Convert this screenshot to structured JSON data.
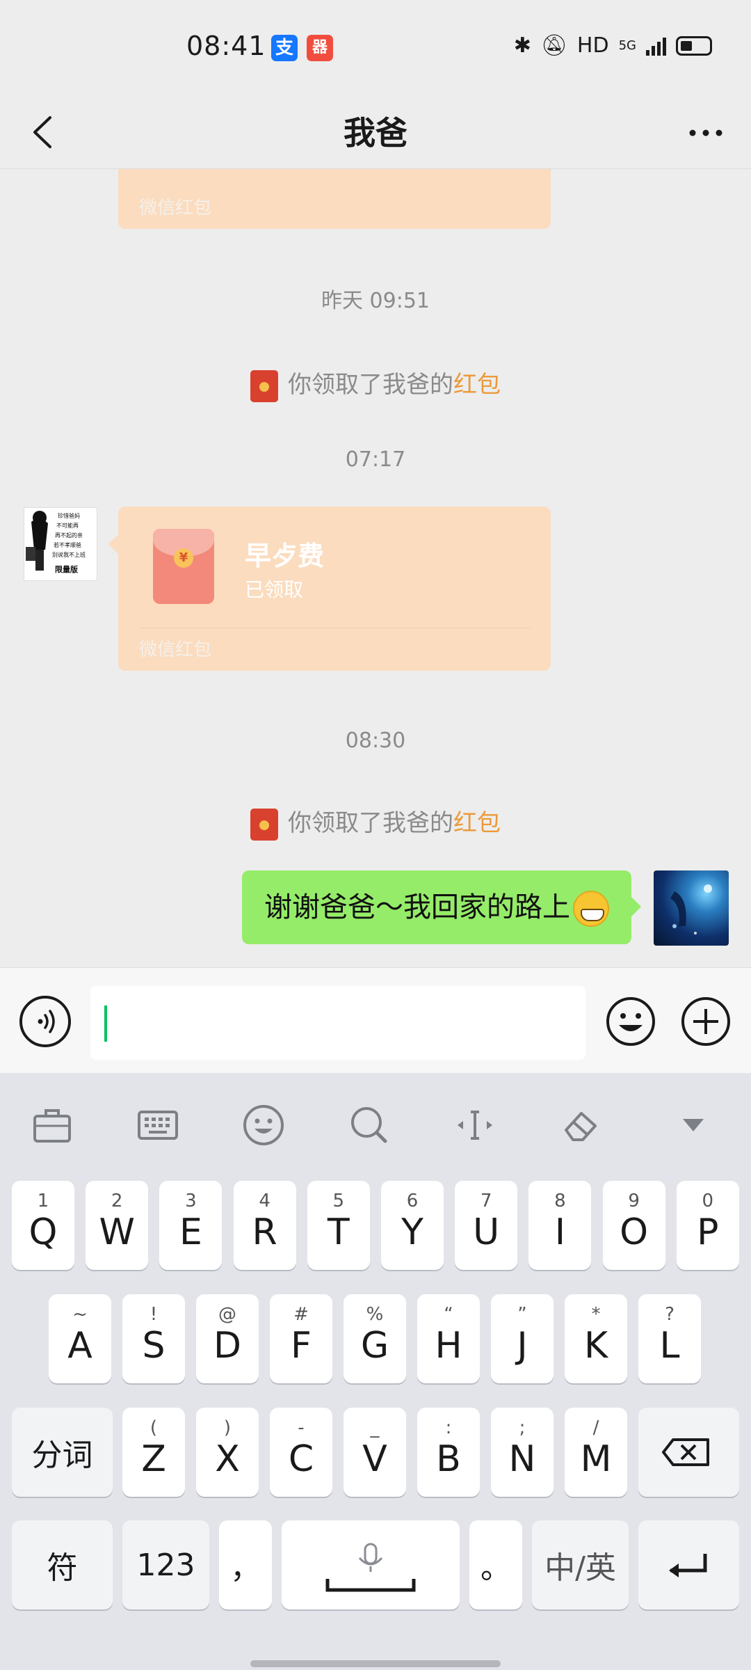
{
  "status_bar": {
    "time": "08:41",
    "app_icons": [
      {
        "name": "alipay-icon",
        "glyph": "支",
        "color": "#1677ff"
      },
      {
        "name": "app-icon",
        "glyph": "器",
        "color": "#f04d3f"
      }
    ],
    "network": "HD",
    "network_type": "5G"
  },
  "header": {
    "title": "我爸"
  },
  "chat": {
    "top_red_packet_footer": "微信红包",
    "messages": [
      {
        "type": "timestamp",
        "text": "昨天 09:51"
      },
      {
        "type": "system",
        "prefix": "你领取了我爸的",
        "highlight": "红包"
      },
      {
        "type": "timestamp",
        "text": "07:17"
      },
      {
        "type": "system",
        "prefix": "你领取了我爸的",
        "highlight": "红包"
      },
      {
        "type": "timestamp",
        "text": "08:30"
      }
    ],
    "red_packet": {
      "title": "早歺费",
      "status": "已领取",
      "footer": "微信红包",
      "coin": "¥"
    },
    "avatar_left_lines": [
      "珍惜爸妈",
      "不可能再",
      "再不起的亲",
      "若不孝顺爸",
      "别说我不上班",
      "限量版"
    ],
    "outgoing": {
      "text": "谢谢爸爸～我回家的路上",
      "emoji": "grin"
    }
  },
  "input_bar": {
    "value": ""
  },
  "keyboard": {
    "toolbar": [
      "briefcase-icon",
      "keyboard-icon",
      "emoji-icon",
      "search-icon",
      "cursor-icon",
      "eraser-icon",
      "collapse-icon"
    ],
    "row1": [
      {
        "k": "Q",
        "h": "1"
      },
      {
        "k": "W",
        "h": "2"
      },
      {
        "k": "E",
        "h": "3"
      },
      {
        "k": "R",
        "h": "4"
      },
      {
        "k": "T",
        "h": "5"
      },
      {
        "k": "Y",
        "h": "6"
      },
      {
        "k": "U",
        "h": "7"
      },
      {
        "k": "I",
        "h": "8"
      },
      {
        "k": "O",
        "h": "9"
      },
      {
        "k": "P",
        "h": "0"
      }
    ],
    "row2": [
      {
        "k": "A",
        "h": "~"
      },
      {
        "k": "S",
        "h": "!"
      },
      {
        "k": "D",
        "h": "@"
      },
      {
        "k": "F",
        "h": "#"
      },
      {
        "k": "G",
        "h": "%"
      },
      {
        "k": "H",
        "h": "“"
      },
      {
        "k": "J",
        "h": "”"
      },
      {
        "k": "K",
        "h": "*"
      },
      {
        "k": "L",
        "h": "?"
      }
    ],
    "row3": [
      {
        "k": "Z",
        "h": "("
      },
      {
        "k": "X",
        "h": ")"
      },
      {
        "k": "C",
        "h": "-"
      },
      {
        "k": "V",
        "h": "_"
      },
      {
        "k": "B",
        "h": ":"
      },
      {
        "k": "N",
        "h": ";"
      },
      {
        "k": "M",
        "h": "/"
      }
    ],
    "segment_label": "分词",
    "symbol_label": "符",
    "number_label": "123",
    "comma": "，",
    "period": "。",
    "lang_label": "中/英"
  }
}
